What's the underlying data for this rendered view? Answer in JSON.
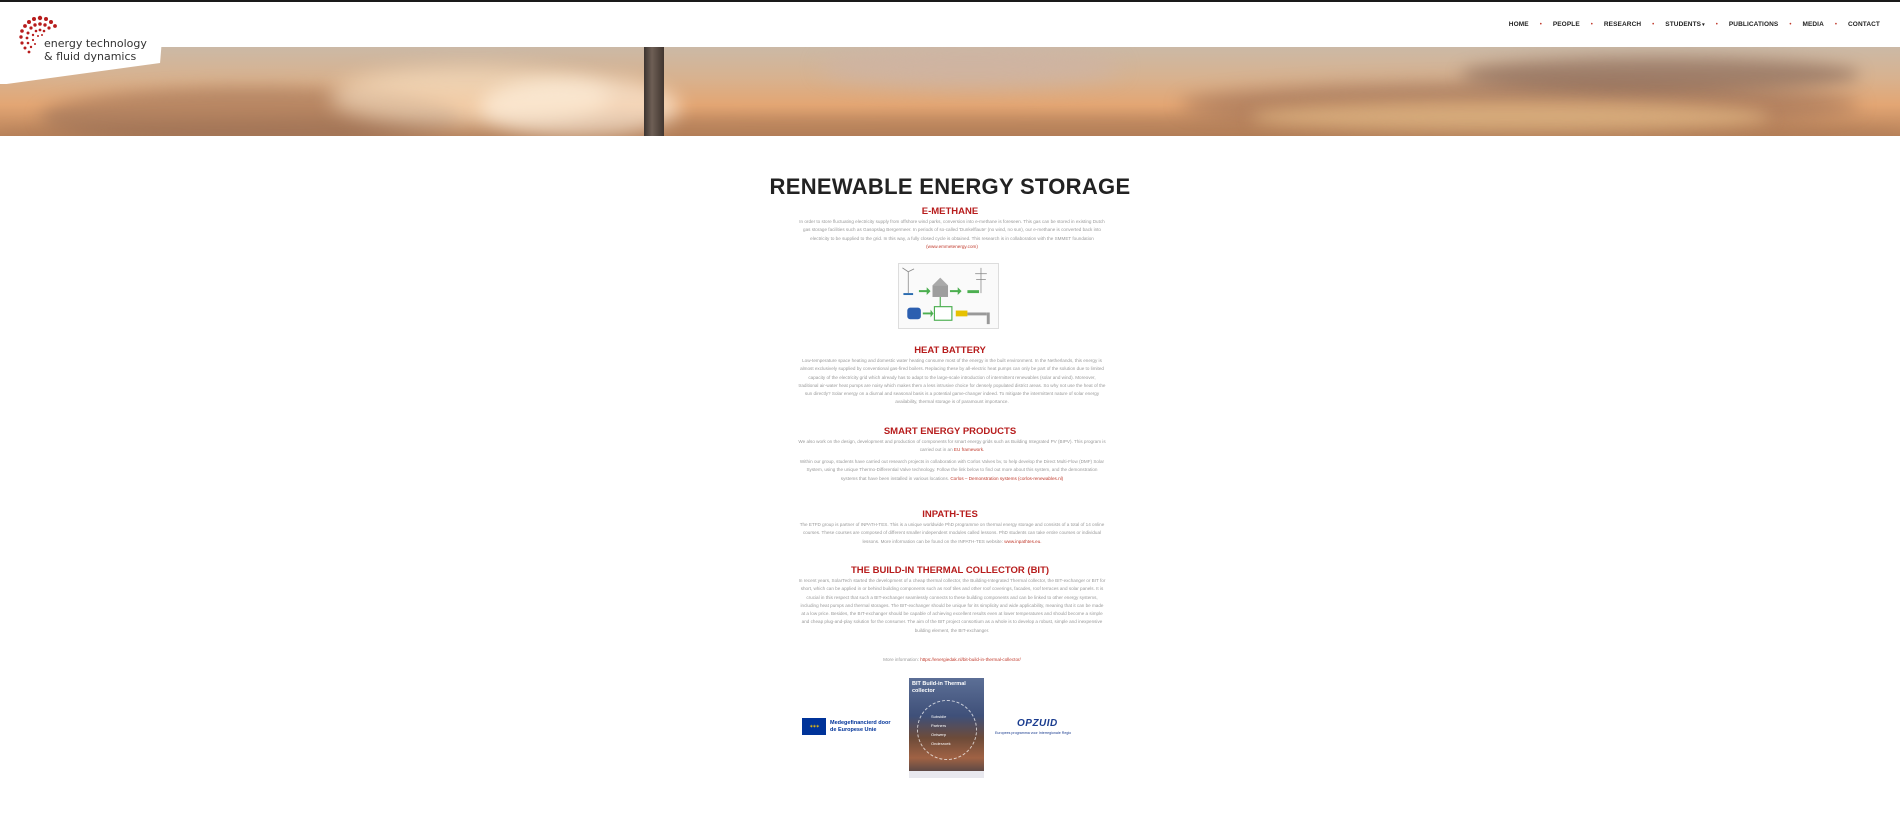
{
  "header": {
    "logo_line1": "energy technology",
    "logo_line2": "& fluid dynamics",
    "nav": [
      "HOME",
      "PEOPLE",
      "RESEARCH",
      "STUDENTS",
      "PUBLICATIONS",
      "MEDIA",
      "CONTACT"
    ],
    "students_caret": "▾",
    "separator": "•"
  },
  "page": {
    "title": "RENEWABLE ENERGY STORAGE"
  },
  "sections": {
    "emethane": {
      "title": "E-METHANE",
      "text": "In order to store fluctuating electricity supply from offshore wind parks, conversion into e-methane is foreseen. This gas can be stored in existing Dutch gas storage facilities such as Gasopslag Bergermeer. In periods of so-called 'Dunkelflaute' (no wind, no sun), our e-methane is converted back into electricity to be supplied to the grid. In this way, a fully closed cycle is obtained. This research is in collaboration with the SMMET foundation",
      "link": "(www.emmetenergy.com)"
    },
    "heat_battery": {
      "title": "HEAT BATTERY",
      "text": "Low-temperature space heating and domestic water heating consume most of the energy in the built environment. In the Netherlands, this energy is almost exclusively supplied by conventional gas-fired boilers. Replacing these by all-electric heat pumps can only be part of the solution due to limited capacity of the electricity grid which already has to adapt to the large-scale introduction of intermittent renewables (solar and wind). Moreover, traditional air-water heat pumps are noisy which makes them a less intrusive choice for densely populated district areas. So why not use the heat of the sun directly? Solar energy on a diurnal and seasonal basis is a potential game-changer indeed. To mitigate the intermittent nature of solar energy availability, thermal storage is of paramount importance."
    },
    "smart": {
      "title": "SMART ENERGY PRODUCTS",
      "text1": "We also work on the design, development and production of components for smart energy grids such as Building Integrated PV (BIPV). This program is carried out in an",
      "link1": "EU framework.",
      "text2": "Within our group, students have carried out research projects in collaboration with Corlos Valves bv, to help develop the Direct Multi-Flow (DMF) Solar System, using the unique Thermo-Differential Valve technology. Follow the link below to find out more about this system, and the demonstration systems that have been installed in various locations.",
      "link2": "Corlos – Demonstration systems (corlos-renewables.nl)"
    },
    "inpath": {
      "title": "INPATH-TES",
      "text": "The ETFD group is partner of INPATH-TES. This is a unique worldwide PhD programme on thermal energy storage and consists of a total of 14 online courses. These courses are composed of different smaller independent modules called lessons. PhD students can take entire courses or individual lessons. More information can be found on the INPATH-TES website:",
      "link": "www.inpathtes.eu."
    },
    "bit": {
      "title": "THE BUILD-IN THERMAL COLLECTOR (BIT)",
      "text": "In recent years, SolarTech started the development of a cheap thermal collector, the Building-Integrated Thermal collector, the BIT-exchanger or BIT for short, which can be applied in or behind building components such as roof tiles and other roof coverings, facades, roof terraces and solar panels. It is crucial in this respect that such a BIT-exchanger seamlessly connects to these building components and can be linked to other energy systems, including heat pumps and thermal storages. The BIT-exchanger should be unique for its simplicity and wide applicability, meaning that it can be made at a low price. Besides, the BIT-exchanger should be capable of achieving excellent results even at lower temperatures and should become a simple and cheap plug-and-play solution for the consumer. The aim of the BIT project consortium as a whole is to develop a robust, simple and inexpensive building element, the BIT-exchanger.",
      "more_label": "More information:",
      "more_link": "https://energiedak.nl/bit-build-in-thermal-collector/"
    }
  },
  "footer_logos": {
    "eu_line1": "Medegefinancierd door",
    "eu_line2": "de Europese Unie",
    "poster_title": "BIT Build-in Thermal collector",
    "poster_items": [
      "Subsidie",
      "Partners",
      "Ontwerp",
      "Onderzoek"
    ],
    "opzuid_name": "OPZUID",
    "opzuid_sub": "Europees programma voor Interregionale Regio",
    "eu_color": "#003399",
    "accent": "#b71c1c"
  }
}
